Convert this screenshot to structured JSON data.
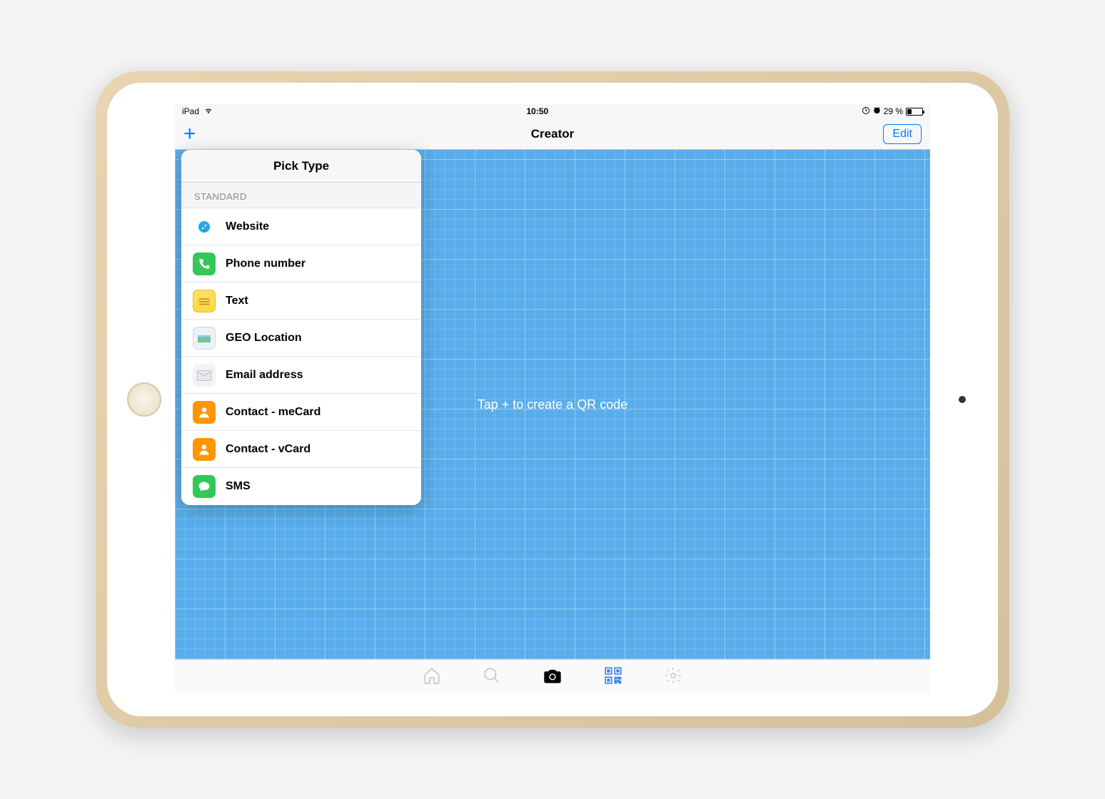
{
  "statusBar": {
    "device": "iPad",
    "time": "10:50",
    "battery": "29 %"
  },
  "navBar": {
    "title": "Creator",
    "editLabel": "Edit"
  },
  "content": {
    "emptyText": "Tap + to create a QR code"
  },
  "popover": {
    "title": "Pick Type",
    "sectionHeader": "STANDARD",
    "items": [
      {
        "label": "Website",
        "iconName": "safari-icon",
        "iconBg": "#1aa9f4"
      },
      {
        "label": "Phone number",
        "iconName": "phone-icon",
        "iconBg": "#34c759"
      },
      {
        "label": "Text",
        "iconName": "notes-icon",
        "iconBg": "#ffd93d"
      },
      {
        "label": "GEO Location",
        "iconName": "map-icon",
        "iconBg": "#eef2f7"
      },
      {
        "label": "Email address",
        "iconName": "mail-icon",
        "iconBg": "#f2f2f7"
      },
      {
        "label": "Contact - meCard",
        "iconName": "contact-icon",
        "iconBg": "#ff9500"
      },
      {
        "label": "Contact - vCard",
        "iconName": "contact-icon",
        "iconBg": "#ff9500"
      },
      {
        "label": "SMS",
        "iconName": "messages-icon",
        "iconBg": "#34c759"
      }
    ]
  }
}
